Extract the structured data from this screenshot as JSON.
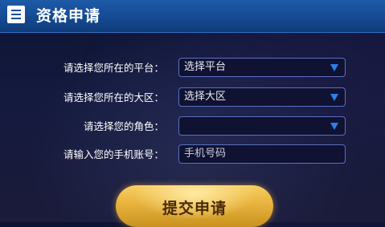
{
  "header": {
    "title": "资格申请",
    "icon": "document-list-icon"
  },
  "form": {
    "platform_label": "请选择您所在的平台：",
    "platform_value": "选择平台",
    "region_label": "请选择您所在的大区：",
    "region_value": "选择大区",
    "role_label": "请选择您的角色：",
    "role_value": "",
    "phone_label": "请输入您的手机账号：",
    "phone_placeholder": "手机号码"
  },
  "submit_label": "提交申请",
  "colors": {
    "header": "#1d5aa8",
    "caret": "#2e7fe6",
    "button": "#e7b23c"
  }
}
